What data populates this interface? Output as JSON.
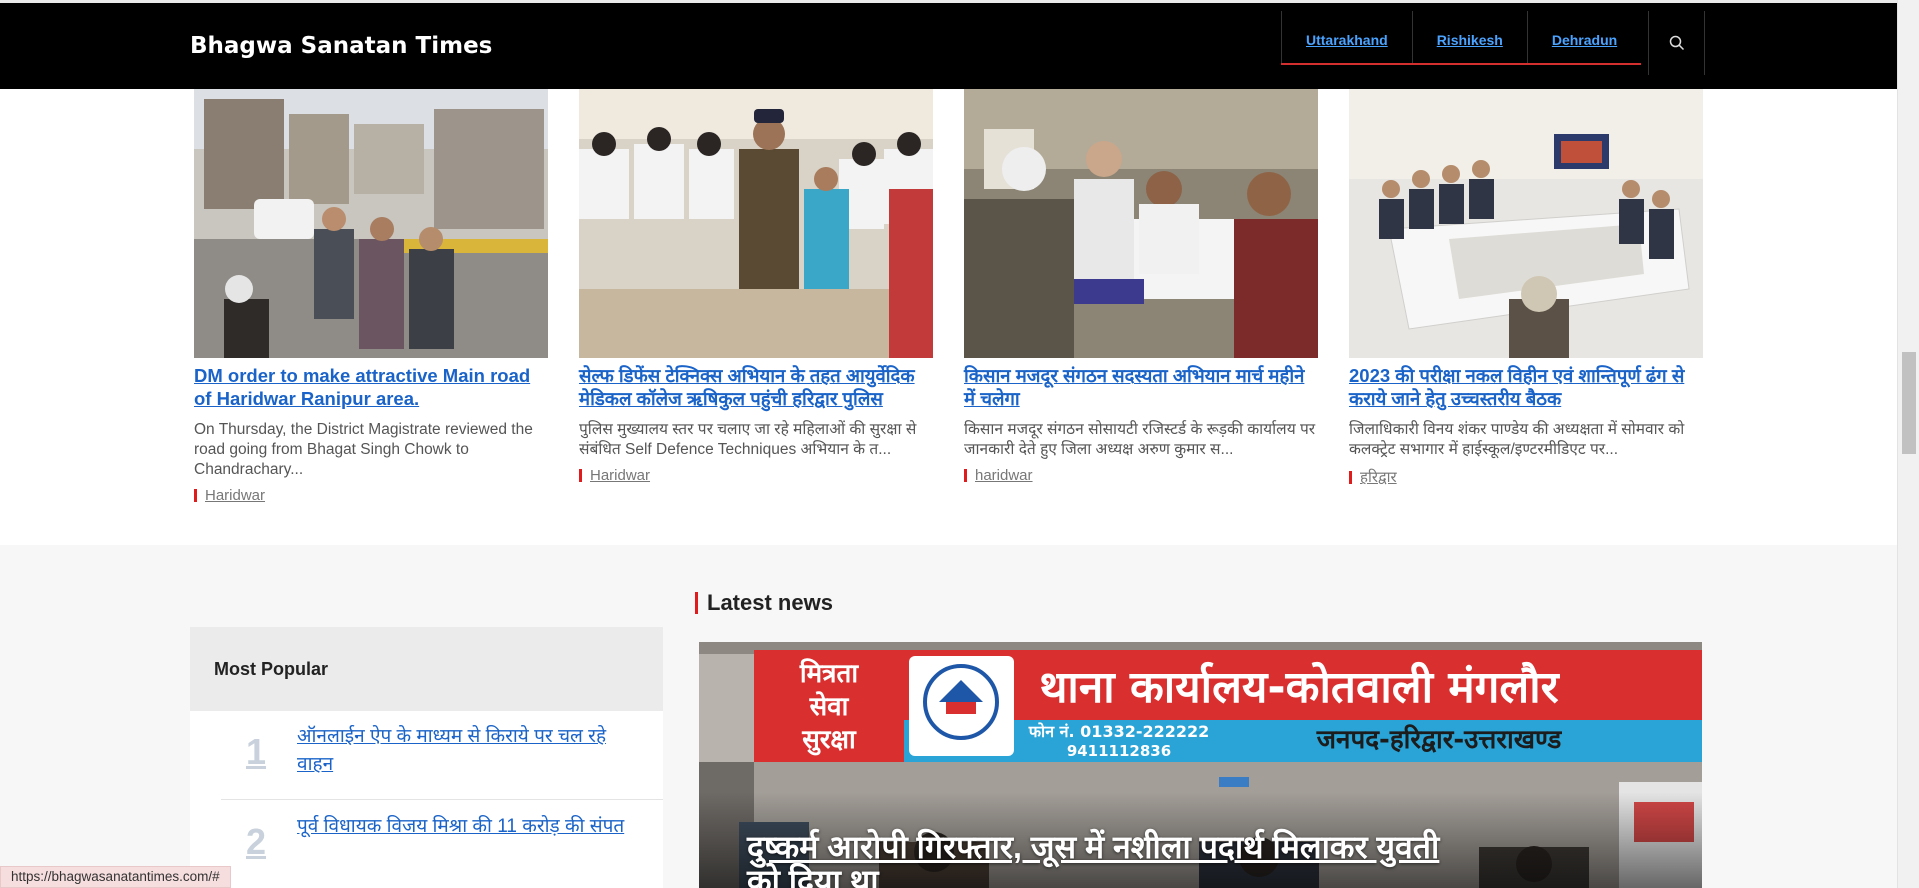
{
  "site": {
    "brand": "Bhagwa Sanatan Times"
  },
  "nav": {
    "items": [
      "Uttarakhand",
      "Rishikesh",
      "Dehradun"
    ]
  },
  "cards": [
    {
      "title": "DM order to make attractive Main road of Haridwar Ranipur area.",
      "excerpt": "On Thursday, the District Magistrate reviewed the road going from Bhagat Singh Chowk to Chandrachary...",
      "category": "Haridwar"
    },
    {
      "title": "सेल्फ डिफेंस टेक्निक्स अभियान के तहत आयुर्वेदिक मेडिकल कॉलेज ऋषिकुल पहुंची हरिद्वार पुलिस",
      "excerpt": "पुलिस मुख्यालय स्तर पर चलाए जा रहे महिलाओं की सुरक्षा से संबंधित Self Defence Techniques अभियान के त...",
      "category": "Haridwar"
    },
    {
      "title": "किसान मजदूर संगठन सदस्यता अभियान मार्च महीने में चलेगा",
      "excerpt": "किसान मजदूर संगठन सोसायटी रजिस्टर्ड के रूड़की कार्यालय पर जानकारी देते हुए जिला अध्यक्ष अरुण कुमार स...",
      "category": "haridwar"
    },
    {
      "title": "2023 की परीक्षा नकल विहीन एवं शान्तिपूर्ण ढंग से कराये जाने हेतु उच्चस्तरीय बैठक",
      "excerpt": "जिलाधिकारी विनय शंकर पाण्डेय की अध्यक्षता में सोमवार को कलक्ट्रेट सभागार में हाईस्कूल/इण्टरमीडिएट पर...",
      "category": "हरिद्वार"
    }
  ],
  "popular": {
    "heading": "Most Popular",
    "items": [
      {
        "num": "1",
        "title": "ऑनलाईन ऐप के माध्यम से किराये पर चल रहे वाहन"
      },
      {
        "num": "2",
        "title": "पूर्व विधायक विजय मिश्रा की 11 करोड़ की संपत"
      }
    ]
  },
  "latest": {
    "heading": "Latest news",
    "hero_title": "दुष्कर्म आरोपी गिरफ्तार, जूस में नशीला पदार्थ मिलाकर युवती को दिया था",
    "signboard": {
      "left_words": [
        "मित्रता",
        "सेवा",
        "सुरक्षा"
      ],
      "main": "थाना कार्यालय-कोतवाली मंगलौर",
      "phone_label": "फोन नं. 01332-222222",
      "phone2": "9411112836",
      "district": "जनपद-हरिद्वार-उत्तराखण्ड"
    }
  },
  "status_bar": {
    "url": "https://bhagwasanatantimes.com/#"
  },
  "colors": {
    "accent": "#e01b1b",
    "link": "#1a63c8",
    "nav_link": "#4aa3ff",
    "header_bg": "#000000"
  }
}
